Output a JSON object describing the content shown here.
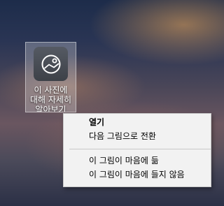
{
  "desktop_icon": {
    "label": "이 사진에 대해 자세히 알아보기",
    "icon": "picture-icon"
  },
  "context_menu": {
    "items": [
      {
        "label": "열기",
        "bold": true
      },
      {
        "label": "다음 그림으로 전환"
      },
      {
        "label": "이 그림이 마음에 듦"
      },
      {
        "label": "이 그림이 마음에 들지 않음"
      }
    ]
  }
}
